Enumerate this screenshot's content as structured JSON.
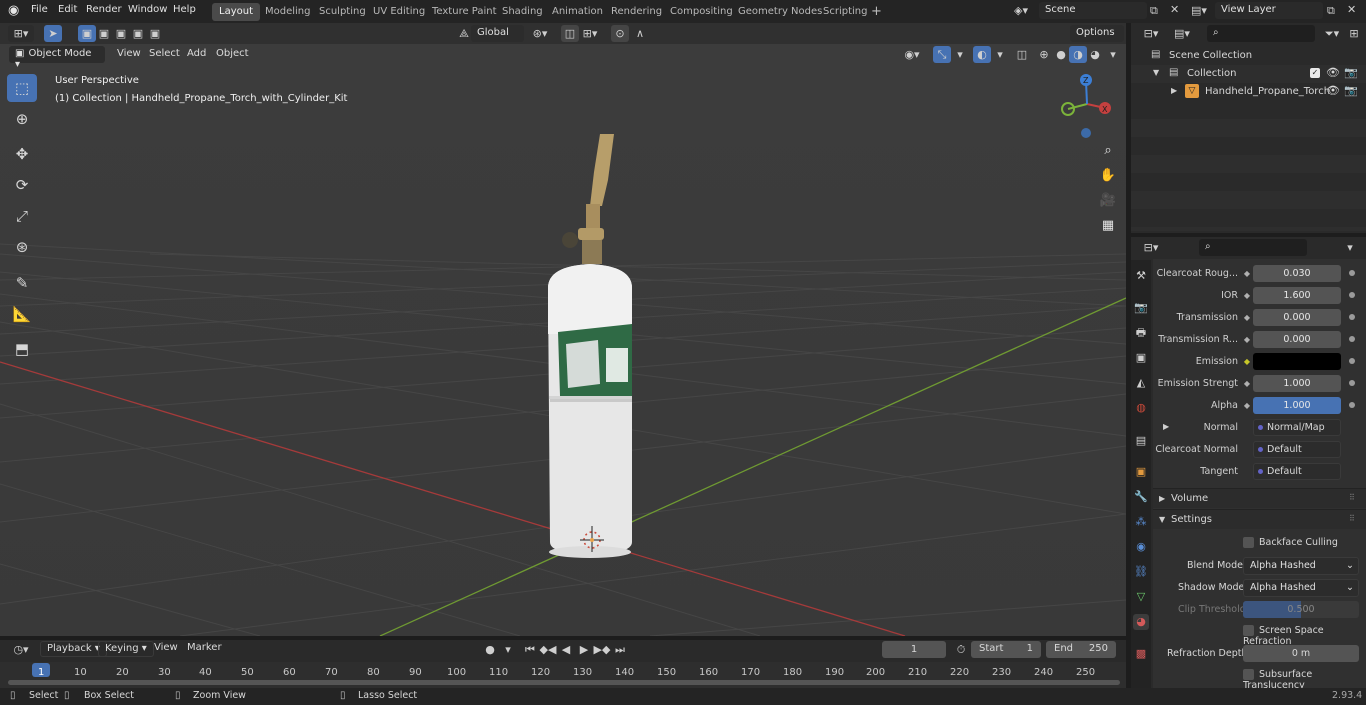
{
  "topbar": {
    "menus": [
      "File",
      "Edit",
      "Render",
      "Window",
      "Help"
    ],
    "workspaces": [
      "Layout",
      "Modeling",
      "Sculpting",
      "UV Editing",
      "Texture Paint",
      "Shading",
      "Animation",
      "Rendering",
      "Compositing",
      "Geometry Nodes",
      "Scripting"
    ],
    "active_workspace": "Layout",
    "scene": "Scene",
    "view_layer": "View Layer"
  },
  "viewport_header": {
    "mode": "Object Mode",
    "menus": [
      "View",
      "Select",
      "Add",
      "Object"
    ],
    "orientation": "Global",
    "options": "Options"
  },
  "viewport": {
    "perspective": "User Perspective",
    "collection_info": "(1) Collection | Handheld_Propane_Torch_with_Cylinder_Kit"
  },
  "outliner": {
    "scene_collection": "Scene Collection",
    "collection": "Collection",
    "object": "Handheld_Propane_Torch"
  },
  "properties": {
    "rows": [
      {
        "label": "Clearcoat Roug...",
        "value": "0.030",
        "kind": "num"
      },
      {
        "label": "IOR",
        "value": "1.600",
        "kind": "num"
      },
      {
        "label": "Transmission",
        "value": "0.000",
        "kind": "num"
      },
      {
        "label": "Transmission R...",
        "value": "0.000",
        "kind": "num"
      },
      {
        "label": "Emission",
        "value": "",
        "kind": "color"
      },
      {
        "label": "Emission Strengt",
        "value": "1.000",
        "kind": "num"
      },
      {
        "label": "Alpha",
        "value": "1.000",
        "kind": "blue"
      },
      {
        "label": "Normal",
        "value": "Normal/Map",
        "kind": "link"
      },
      {
        "label": "Clearcoat Normal",
        "value": "Default",
        "kind": "link"
      },
      {
        "label": "Tangent",
        "value": "Default",
        "kind": "link"
      }
    ],
    "volume_panel": "Volume",
    "settings_panel": "Settings",
    "backface_culling": "Backface Culling",
    "blend_mode_label": "Blend Mode",
    "blend_mode": "Alpha Hashed",
    "shadow_mode_label": "Shadow Mode",
    "shadow_mode": "Alpha Hashed",
    "clip_threshold_label": "Clip Threshold",
    "clip_threshold": "0.500",
    "screen_space_refraction": "Screen Space Refraction",
    "refraction_depth_label": "Refraction Depth",
    "refraction_depth": "0 m",
    "subsurface_translucency": "Subsurface Translucency"
  },
  "timeline": {
    "menus": [
      "Playback",
      "Keying",
      "View",
      "Marker"
    ],
    "current_frame": "1",
    "start_label": "Start",
    "start": "1",
    "end_label": "End",
    "end": "250",
    "ticks": [
      "1",
      "10",
      "20",
      "30",
      "40",
      "50",
      "60",
      "70",
      "80",
      "90",
      "100",
      "110",
      "120",
      "130",
      "140",
      "150",
      "160",
      "170",
      "180",
      "190",
      "200",
      "210",
      "220",
      "230",
      "240",
      "250"
    ]
  },
  "statusbar": {
    "select": "Select",
    "box_select": "Box Select",
    "zoom_view": "Zoom View",
    "lasso_select": "Lasso Select",
    "version": "2.93.4"
  },
  "colors": {
    "accent": "#4772b3",
    "x_axis": "#c4403f",
    "y_axis": "#7bb33a",
    "z_axis": "#3c7fd6"
  }
}
